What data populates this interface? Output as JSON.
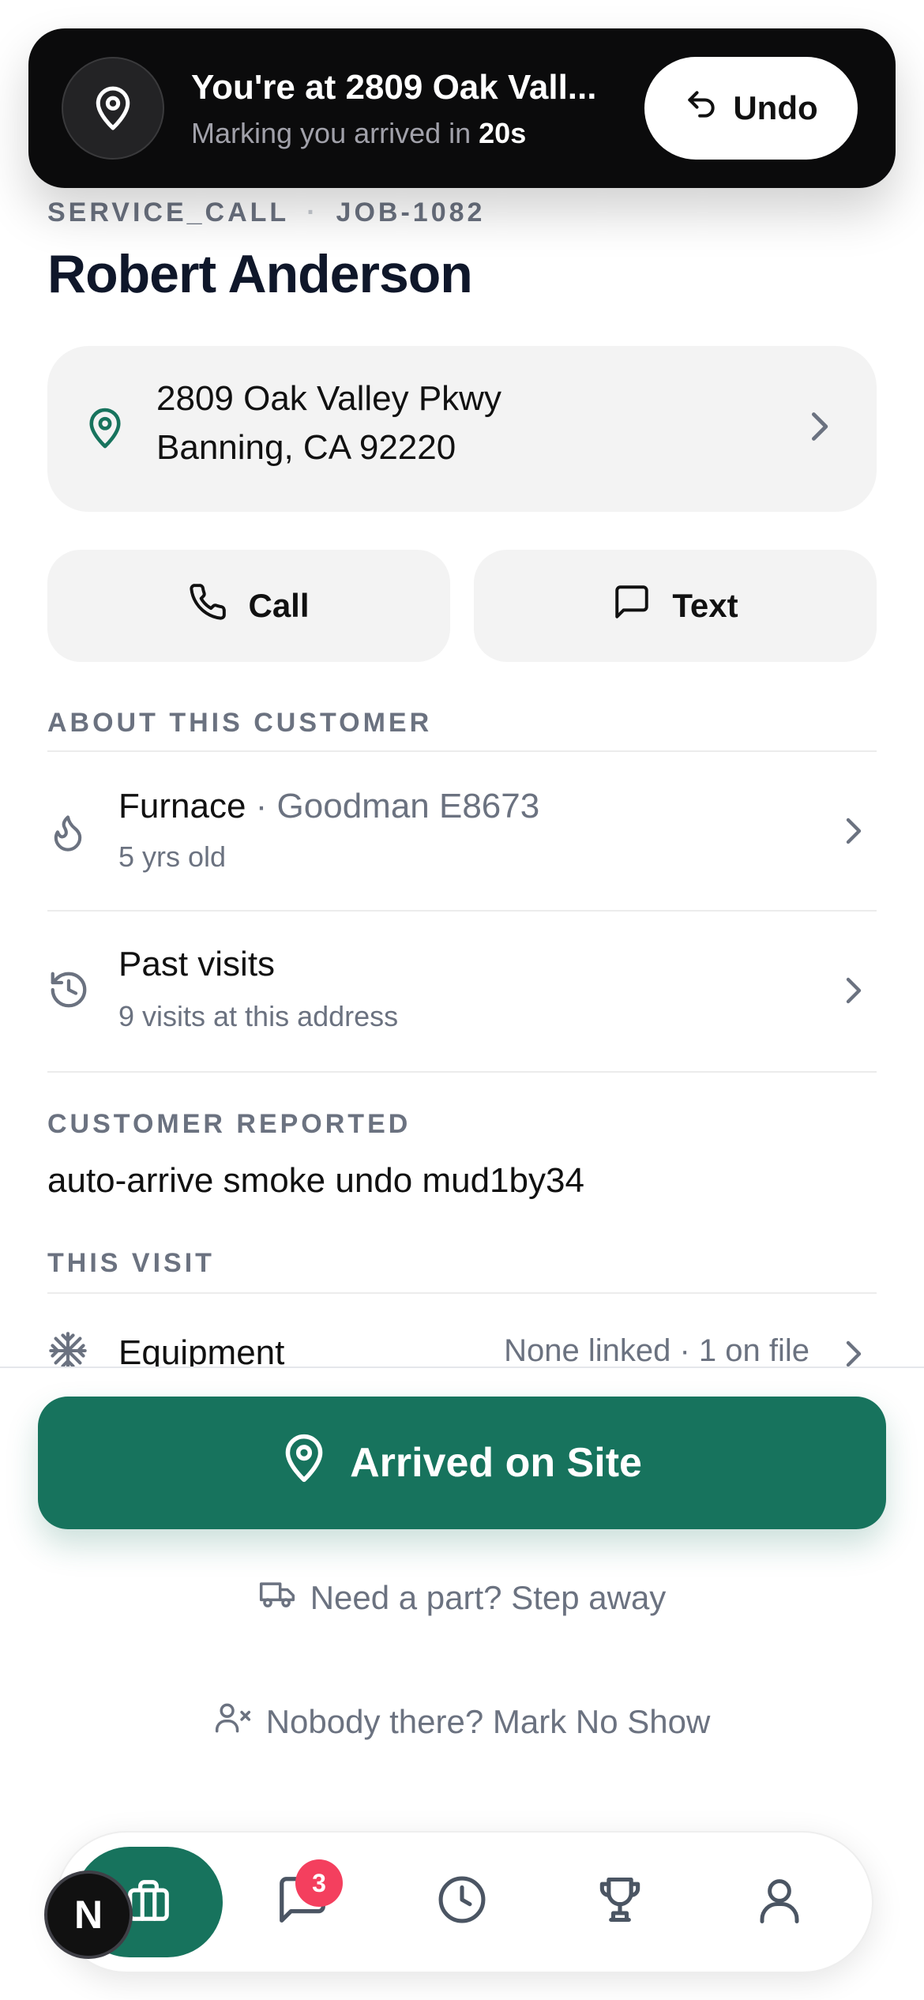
{
  "banner": {
    "title": "You're at 2809 Oak Vall...",
    "subtitle_prefix": "Marking you arrived in ",
    "countdown": "20s",
    "undo_label": "Undo"
  },
  "job": {
    "type": "SERVICE_CALL",
    "separator": "·",
    "number": "JOB-1082",
    "customer_name": "Robert Anderson"
  },
  "address": {
    "line1": "2809 Oak Valley Pkwy",
    "line2": "Banning, CA 92220"
  },
  "actions": {
    "call_label": "Call",
    "text_label": "Text"
  },
  "about": {
    "heading": "ABOUT THIS CUSTOMER",
    "furnace": {
      "title": "Furnace",
      "detail": " · Goodman E8673",
      "sub": "5 yrs old"
    },
    "past_visits": {
      "title": "Past visits",
      "sub": "9 visits at this address"
    }
  },
  "reported": {
    "heading": "CUSTOMER REPORTED",
    "text": "auto-arrive smoke undo mud1by34"
  },
  "this_visit": {
    "heading": "THIS VISIT",
    "equipment_label": "Equipment",
    "equipment_value": "None linked · 1 on file"
  },
  "bottom": {
    "arrived_label": "Arrived on Site",
    "need_part_label": "Need a part? Step away",
    "no_show_label": "Nobody there? Mark No Show"
  },
  "tabbar": {
    "messages_badge": "3",
    "avatar_letter": "N"
  },
  "colors": {
    "brand_green": "#17735d",
    "badge_red": "#f43f5e",
    "banner_bg": "#0b0b0c"
  }
}
